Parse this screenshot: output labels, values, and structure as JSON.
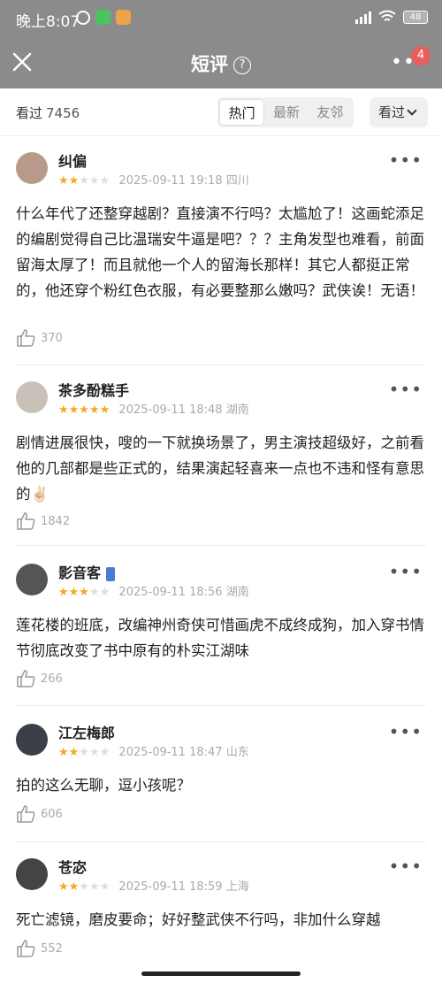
{
  "status_bar": {
    "time": "晚上8:07",
    "battery": "48"
  },
  "header": {
    "title": "短评",
    "help": "?",
    "badge": "4"
  },
  "filter": {
    "seen_label": "看过",
    "seen_count": "7456",
    "tabs": [
      "热门",
      "最新",
      "友邻"
    ],
    "active_tab": "热门",
    "dropdown_label": "看过"
  },
  "comments": [
    {
      "user": "纠偏",
      "stars": 2,
      "time": "2025-09-11 19:18",
      "location": "四川",
      "text": "什么年代了还整穿越剧？直接演不行吗？太尴尬了！这画蛇添足的编剧觉得自己比温瑞安牛逼是吧？？？主角发型也难看，前面留海太厚了！而且就他一个人的留海长那样！其它人都挺正常的，他还穿个粉红色衣服，有必要整那么嫩吗？武侠诶！无语！",
      "likes": "370",
      "avatar_color": "#b99a8a"
    },
    {
      "user": "茶多酚糕手",
      "stars": 5,
      "time": "2025-09-11 18:48",
      "location": "湖南",
      "text": "剧情进展很快，嗖的一下就换场景了，男主演技超级好，之前看他的几部都是些正式的，结果演起轻喜来一点也不违和怪有意思的✌🏻",
      "likes": "1842",
      "avatar_color": "#c7c1b8"
    },
    {
      "user": "影音客",
      "stars": 3,
      "time": "2025-09-11 18:56",
      "location": "湖南",
      "text": "莲花楼的班底，改编神州奇侠可惜画虎不成终成狗，加入穿书情节彻底改变了书中原有的朴实江湖味",
      "likes": "266",
      "avatar_color": "#555555"
    },
    {
      "user": "江左梅郎",
      "stars": 2,
      "time": "2025-09-11 18:47",
      "location": "山东",
      "text": "拍的这么无聊，逗小孩呢？",
      "likes": "606",
      "avatar_color": "#3a3f4a"
    },
    {
      "user": "苍宓",
      "stars": 2,
      "time": "2025-09-11 18:59",
      "location": "上海",
      "text": "死亡滤镜，磨皮要命；好好整武侠不行吗，非加什么穿越",
      "likes": "552",
      "avatar_color": "#444444"
    }
  ]
}
